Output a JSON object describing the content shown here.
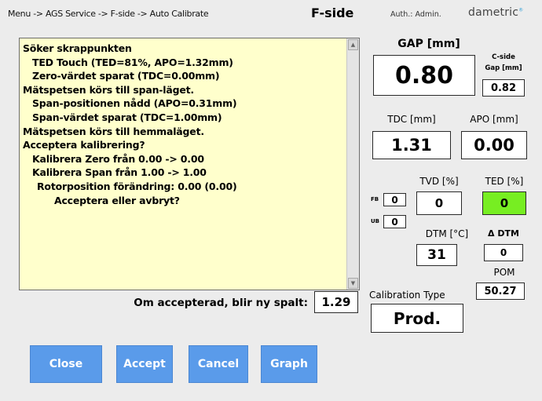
{
  "header": {
    "breadcrumb": "Menu -> AGS Service -> F-side -> Auto Calibrate",
    "title": "F-side",
    "auth": "Auth.: Admin.",
    "brand": "dametric"
  },
  "log": {
    "lines": [
      "Söker skrappunkten",
      "TED Touch (TED=81%, APO=1.32mm)",
      "Zero-värdet sparat (TDC=0.00mm)",
      "Mätspetsen körs till span-läget.",
      "Span-positionen nådd (APO=0.31mm)",
      "Span-värdet sparat (TDC=1.00mm)",
      "Mätspetsen körs till hemmaläget.",
      "Acceptera kalibrering?",
      "Kalibrera Zero från 0.00 -> 0.00",
      "Kalibrera Span från 1.00 -> 1.00",
      "Rotorposition förändring: 0.00 (0.00)",
      "Acceptera eller avbryt?"
    ]
  },
  "gap": {
    "label": "GAP [mm]",
    "value": "0.80"
  },
  "cside": {
    "label1": "C-side",
    "label2": "Gap [mm]",
    "value": "0.82"
  },
  "tdc": {
    "label": "TDC [mm]",
    "value": "1.31"
  },
  "apo": {
    "label": "APO [mm]",
    "value": "0.00"
  },
  "tvd": {
    "label": "TVD [%]",
    "value": "0"
  },
  "ted": {
    "label": "TED [%]",
    "value": "0",
    "color": "#77ee22"
  },
  "fb": {
    "label": "FB",
    "value": "0"
  },
  "ub": {
    "label": "UB",
    "value": "0"
  },
  "dtm": {
    "label": "DTM [°C]",
    "value": "31"
  },
  "delta_dtm": {
    "label": "Δ DTM",
    "value": "0"
  },
  "pom": {
    "label": "POM",
    "value": "50.27"
  },
  "new_gap": {
    "label": "Om accepterad, blir ny spalt:",
    "value": "1.29"
  },
  "calibration": {
    "label": "Calibration Type",
    "value": "Prod."
  },
  "buttons": {
    "close": "Close",
    "accept": "Accept",
    "cancel": "Cancel",
    "graph": "Graph"
  },
  "colors": {
    "button": "#5a9bea",
    "log_bg": "#ffffcc",
    "background": "#ececec"
  }
}
